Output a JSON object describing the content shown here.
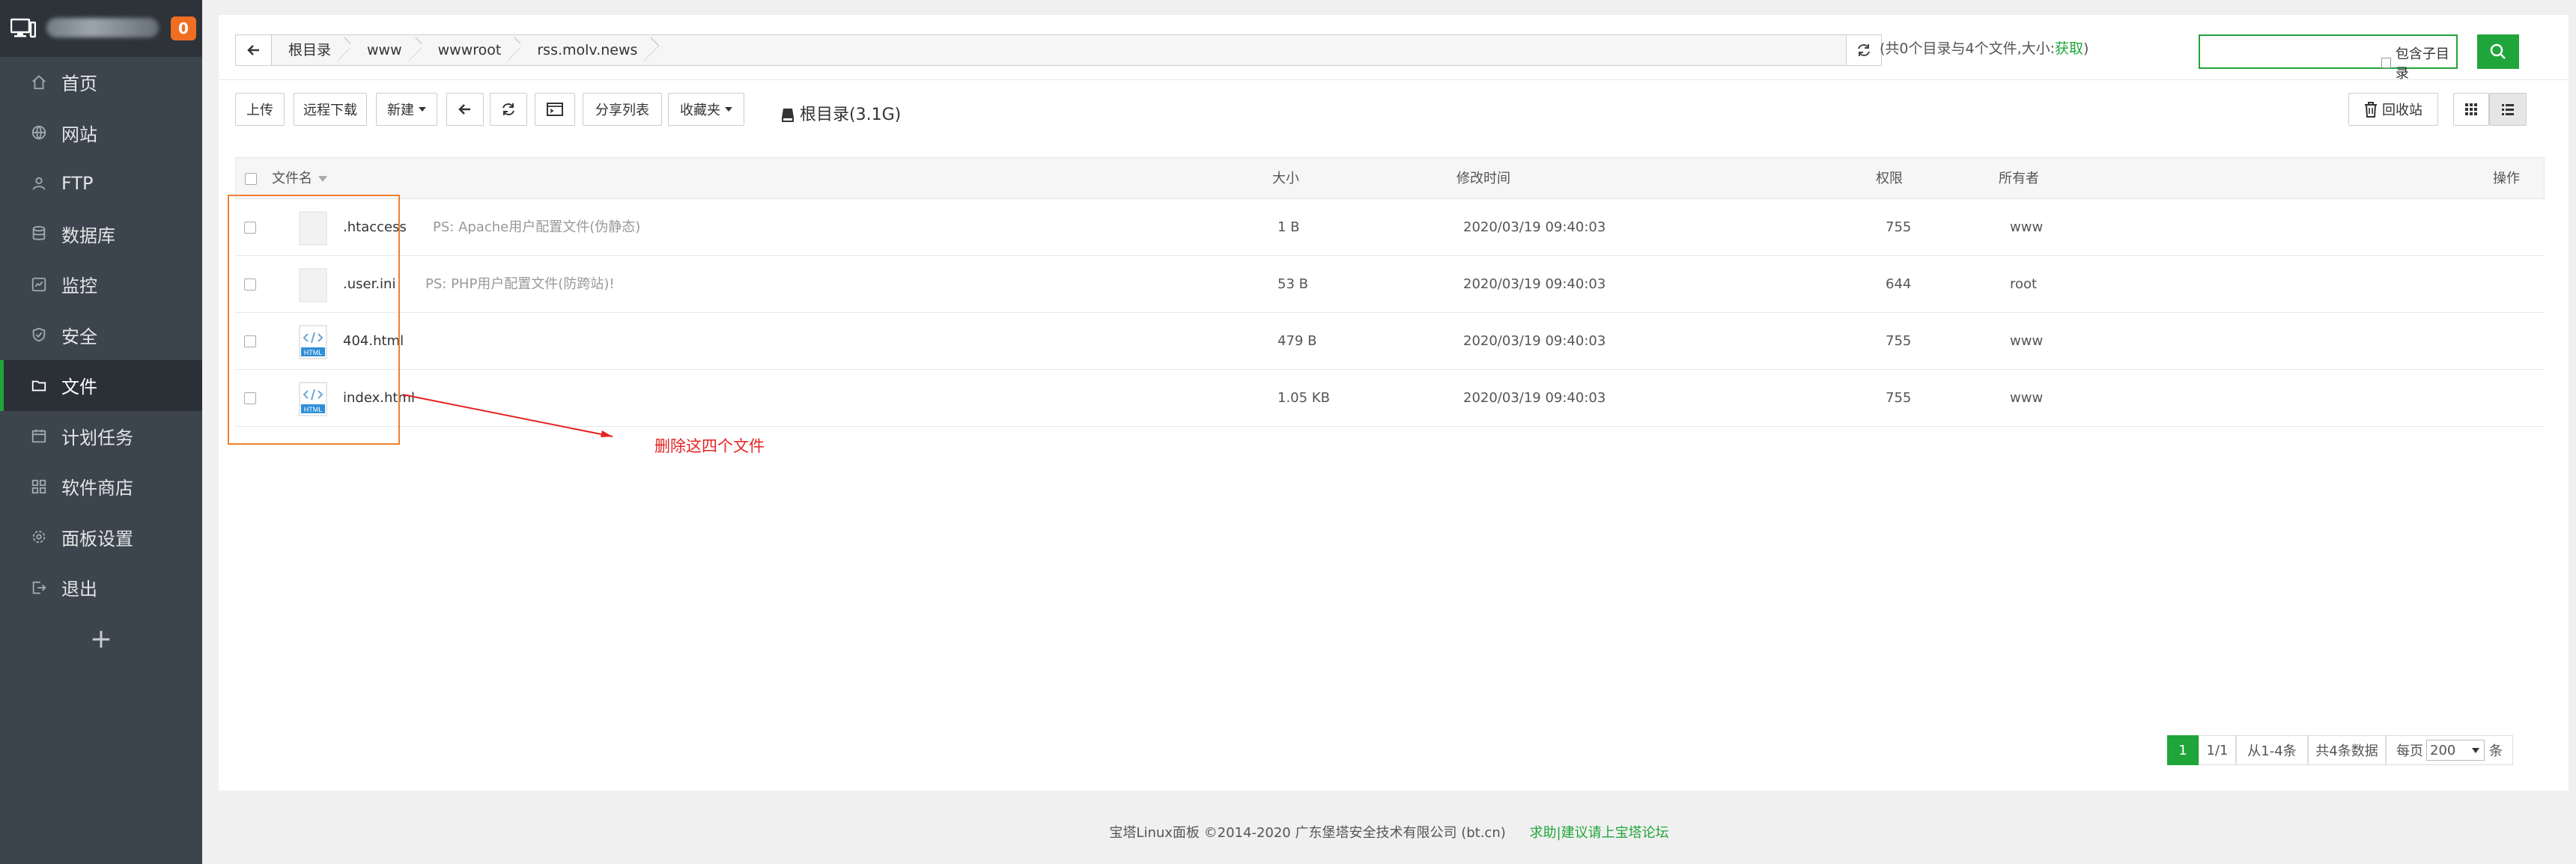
{
  "sidebar": {
    "badge": "0",
    "items": [
      {
        "label": "首页",
        "icon": "home-icon"
      },
      {
        "label": "网站",
        "icon": "globe-icon"
      },
      {
        "label": "FTP",
        "icon": "ftp-icon"
      },
      {
        "label": "数据库",
        "icon": "database-icon"
      },
      {
        "label": "监控",
        "icon": "monitor-icon"
      },
      {
        "label": "安全",
        "icon": "shield-icon"
      },
      {
        "label": "文件",
        "icon": "folder-icon",
        "active": true
      },
      {
        "label": "计划任务",
        "icon": "calendar-icon"
      },
      {
        "label": "软件商店",
        "icon": "grid-icon"
      },
      {
        "label": "面板设置",
        "icon": "gear-icon"
      },
      {
        "label": "退出",
        "icon": "logout-icon"
      }
    ],
    "add": "+"
  },
  "path": {
    "crumbs": [
      "根目录",
      "www",
      "wwwroot",
      "rss.molv.news"
    ],
    "summary_prefix": "(共0个目录与4个文件,大小:",
    "summary_link": "获取",
    "summary_suffix": ")"
  },
  "search": {
    "placeholder": "",
    "sub_label": "包含子目录"
  },
  "toolbar": {
    "upload": "上传",
    "remote_download": "远程下载",
    "new": "新建",
    "share_list": "分享列表",
    "favorites": "收藏夹",
    "disk": "根目录(3.1G)",
    "recycle": "回收站"
  },
  "table": {
    "headers": {
      "name": "文件名",
      "size": "大小",
      "mtime": "修改时间",
      "perm": "权限",
      "owner": "所有者",
      "ops": "操作"
    },
    "rows": [
      {
        "name": ".htaccess",
        "note": "PS: Apache用户配置文件(伪静态)",
        "size": "1 B",
        "mtime": "2020/03/19 09:40:03",
        "perm": "755",
        "owner": "www",
        "type": "file"
      },
      {
        "name": ".user.ini",
        "note": "PS: PHP用户配置文件(防跨站)!",
        "size": "53 B",
        "mtime": "2020/03/19 09:40:03",
        "perm": "644",
        "owner": "root",
        "type": "file"
      },
      {
        "name": "404.html",
        "note": "",
        "size": "479 B",
        "mtime": "2020/03/19 09:40:03",
        "perm": "755",
        "owner": "www",
        "type": "html"
      },
      {
        "name": "index.html",
        "note": "",
        "size": "1.05 KB",
        "mtime": "2020/03/19 09:40:03",
        "perm": "755",
        "owner": "www",
        "type": "html"
      }
    ],
    "html_icon_label": "HTML"
  },
  "annotation": "删除这四个文件",
  "pager": {
    "current": "1",
    "pages": "1/1",
    "range": "从1-4条",
    "total": "共4条数据",
    "per_page_label": "每页",
    "per_page": "200",
    "unit": "条"
  },
  "footer": {
    "copyright": "宝塔Linux面板 ©2014-2020 广东堡塔安全技术有限公司 (bt.cn)",
    "link": "求助|建议请上宝塔论坛"
  },
  "colors": {
    "sidebar": "#3c444d",
    "accent": "#20a53a",
    "badge": "#f06e21",
    "annotation": "#e52323"
  }
}
